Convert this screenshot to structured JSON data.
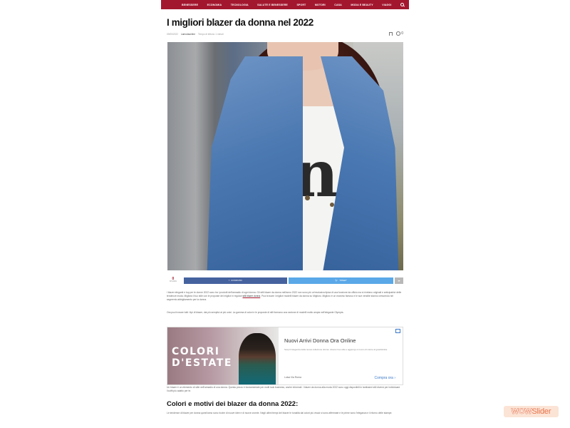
{
  "nav": {
    "items": [
      "Benessere",
      "Economia",
      "Tecnologia",
      "Salute e benessere",
      "Sport",
      "Motori",
      "Casa",
      "Moda e beauty",
      "Viaggi"
    ]
  },
  "article": {
    "title": "I migliori blazer da donna nel 2022",
    "meta": {
      "date": "09/05/2022",
      "author": "Lamodaonline",
      "read_time": "Tempo di lettura: 1 minuti"
    },
    "comments": "0"
  },
  "share": {
    "count": "0",
    "count_label": "SHARES",
    "facebook": "CONDIVIDI",
    "twitter": "TWEET",
    "more_icon": "share-icon"
  },
  "body": {
    "p1": "I blazer eleganti e top per le donne 2022 sono tra i prodotti dell'armadio di ogni donna. Gli stili blazer da donna nell'anno 2022 non sono più un'esclusiva tipica di una funzione da ufficio ma si rivelano originali e anticipatrici delle tendenze moda. Migliora il tuo stile con le proposte dei migliori e regolari",
    "p1_link": "stili blazer donna",
    "p1_tail": ". Puoi trovare i migliori modelli blazer da donna su Miglioro. Miglioro è un marchio famoso e le sue vendite stanno crescendo nel segmento abbigliamento per la donna.",
    "p2": "Ora puoi trovare tutti i tipi di blazer, dai più semplici ai più unici. La gamma di colori e le proposte di stili formano una sezione di modelli molto ampia nell'elegante Olympia.",
    "p3": "Un blazer è un elemento di stile nell'armadio di una donna. Questo pezzo è fondamentale per molti look business, anche informali. I blazer da donna alla moda 2022 sono oggi disponibili in tantissimi stili diversi per individuare l'outfit più adatto per te.",
    "h2": "Colori e motivi dei blazer da donna 2022:",
    "p4": "Le tendenze di blazer per donna quest'anno sono ricche di nuove idee e di nuove cromie. Negli ultimi tempi del blazer le tonalità dai colori più vivaci si sono affermate e le prime sono l'eleganza e il ritorno delle stampe."
  },
  "ad": {
    "image_text": "COLORI D'ESTATE",
    "title": "Nuovi Arrivi Donna Ora Online",
    "desc": "Scopri l'eleganza della nuova collezione donna. Libera il tuo stile e aggiungi un tocco di colore al guardaroba.",
    "brand": "Luisa Via Roma",
    "cta": "Compra ora"
  },
  "watermark": {
    "wow": "WOW",
    "slider": "Slider"
  }
}
